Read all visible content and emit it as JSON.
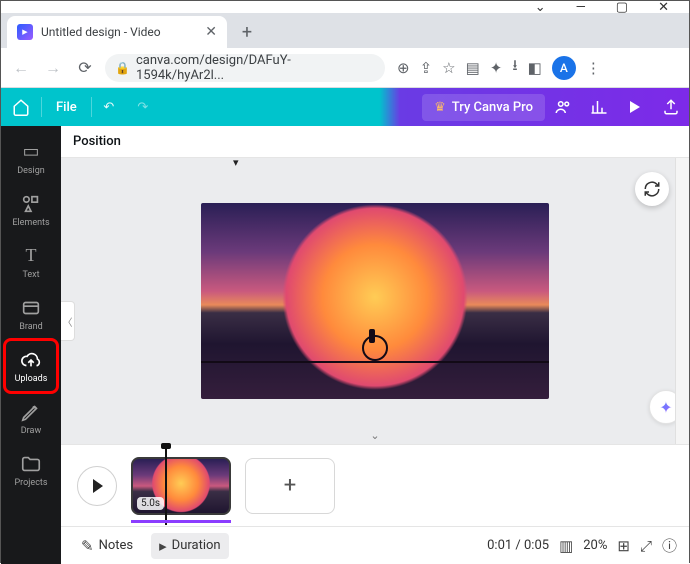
{
  "window": {
    "minimize": "—",
    "maximize": "▢",
    "close": "✕",
    "chevron": "⌄"
  },
  "tab": {
    "title": "Untitled design - Video",
    "close": "✕",
    "new": "+"
  },
  "addressbar": {
    "url": "canva.com/design/DAFuY-1594k/hyAr2l...",
    "avatar_letter": "A"
  },
  "canva_top": {
    "file": "File",
    "try_pro": "Try Canva Pro"
  },
  "rail": {
    "design": "Design",
    "elements": "Elements",
    "text": "Text",
    "brand": "Brand",
    "uploads": "Uploads",
    "draw": "Draw",
    "projects": "Projects"
  },
  "context": {
    "position": "Position"
  },
  "timeline": {
    "clip_duration": "5.0s"
  },
  "status": {
    "notes": "Notes",
    "duration": "Duration",
    "time": "0:01 / 0:05",
    "zoom": "20%"
  }
}
